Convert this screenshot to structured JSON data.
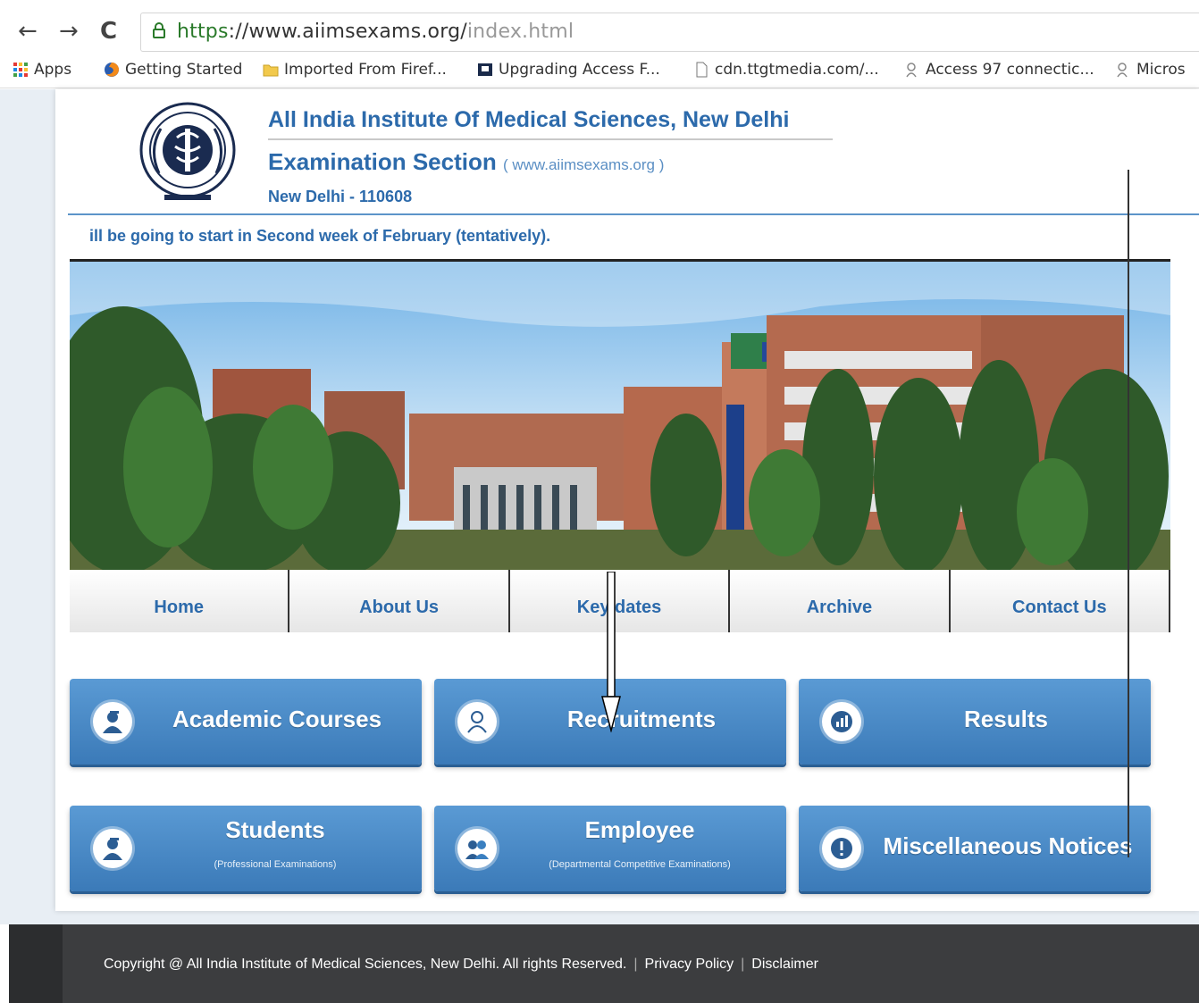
{
  "browser": {
    "back_glyph": "←",
    "forward_glyph": "→",
    "reload_glyph": "C",
    "url_scheme": "https",
    "url_host": "://www.aiimsexams.org/",
    "url_path": "index.html",
    "bookmarks": [
      {
        "label": "Apps",
        "icon": "apps-grid-icon"
      },
      {
        "label": "Getting Started",
        "icon": "firefox-icon"
      },
      {
        "label": "Imported From Firef...",
        "icon": "folder-icon"
      },
      {
        "label": "Upgrading Access F...",
        "icon": "site-icon"
      },
      {
        "label": "cdn.ttgtmedia.com/...",
        "icon": "page-icon"
      },
      {
        "label": "Access 97 connectic...",
        "icon": "link-icon"
      },
      {
        "label": "Micros",
        "icon": "link-icon"
      }
    ]
  },
  "header": {
    "title": "All India Institute Of Medical Sciences, New Delhi",
    "subtitle": "Examination Section",
    "subtitle_url": "( www.aiimsexams.org )",
    "city": "New Delhi - 110608",
    "marquee": "ill be going to start in Second week of February (tentatively)."
  },
  "menu": {
    "items": [
      "Home",
      "About Us",
      "Key dates",
      "Archive",
      "Contact Us"
    ]
  },
  "tiles": {
    "academic": "Academic Courses",
    "recruitments": "Recruitments",
    "results": "Results",
    "students": "Students",
    "students_sub": "(Professional Examinations)",
    "employee": "Employee",
    "employee_sub": "(Departmental Competitive Examinations)",
    "misc": "Miscellaneous Notices"
  },
  "footer": {
    "copyright": "Copyright @ All India Institute of Medical Sciences, New Delhi. All rights Reserved.",
    "privacy": "Privacy Policy",
    "disclaimer": "Disclaimer"
  },
  "colors": {
    "brand_blue": "#2c6aab",
    "tile_blue": "#4a8ac6",
    "footer_dark": "#3c3d3f"
  }
}
